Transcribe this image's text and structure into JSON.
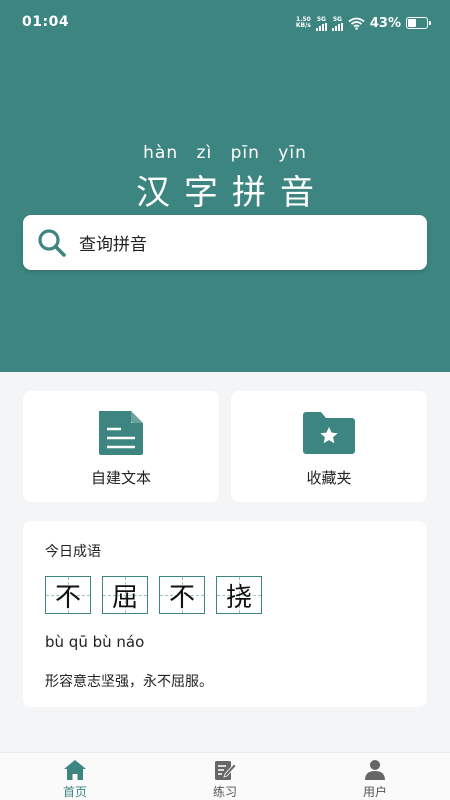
{
  "status": {
    "time": "01:04",
    "speed_value": "1.50",
    "speed_unit": "KB/s",
    "signal1": "5G",
    "signal2": "5G",
    "battery": "43%",
    "battery_level": 0.43
  },
  "header": {
    "pinyin": [
      "hàn",
      "zì",
      "pīn",
      "yīn"
    ],
    "title": "汉字拼音"
  },
  "search": {
    "label": "查询拼音",
    "icon": "search-icon"
  },
  "tiles": [
    {
      "label": "自建文本",
      "icon": "document-icon"
    },
    {
      "label": "收藏夹",
      "icon": "folder-star-icon"
    }
  ],
  "idiom": {
    "heading": "今日成语",
    "chars": [
      "不",
      "屈",
      "不",
      "挠"
    ],
    "pinyin": "bù qū bù náo",
    "definition": "形容意志坚强，永不屈服。"
  },
  "tabs": [
    {
      "label": "首页",
      "icon": "home-icon",
      "active": true
    },
    {
      "label": "练习",
      "icon": "edit-icon",
      "active": false
    },
    {
      "label": "用户",
      "icon": "user-icon",
      "active": false
    }
  ],
  "colors": {
    "primary": "#3d8580",
    "background": "#f4f5f7",
    "card": "#ffffff"
  }
}
